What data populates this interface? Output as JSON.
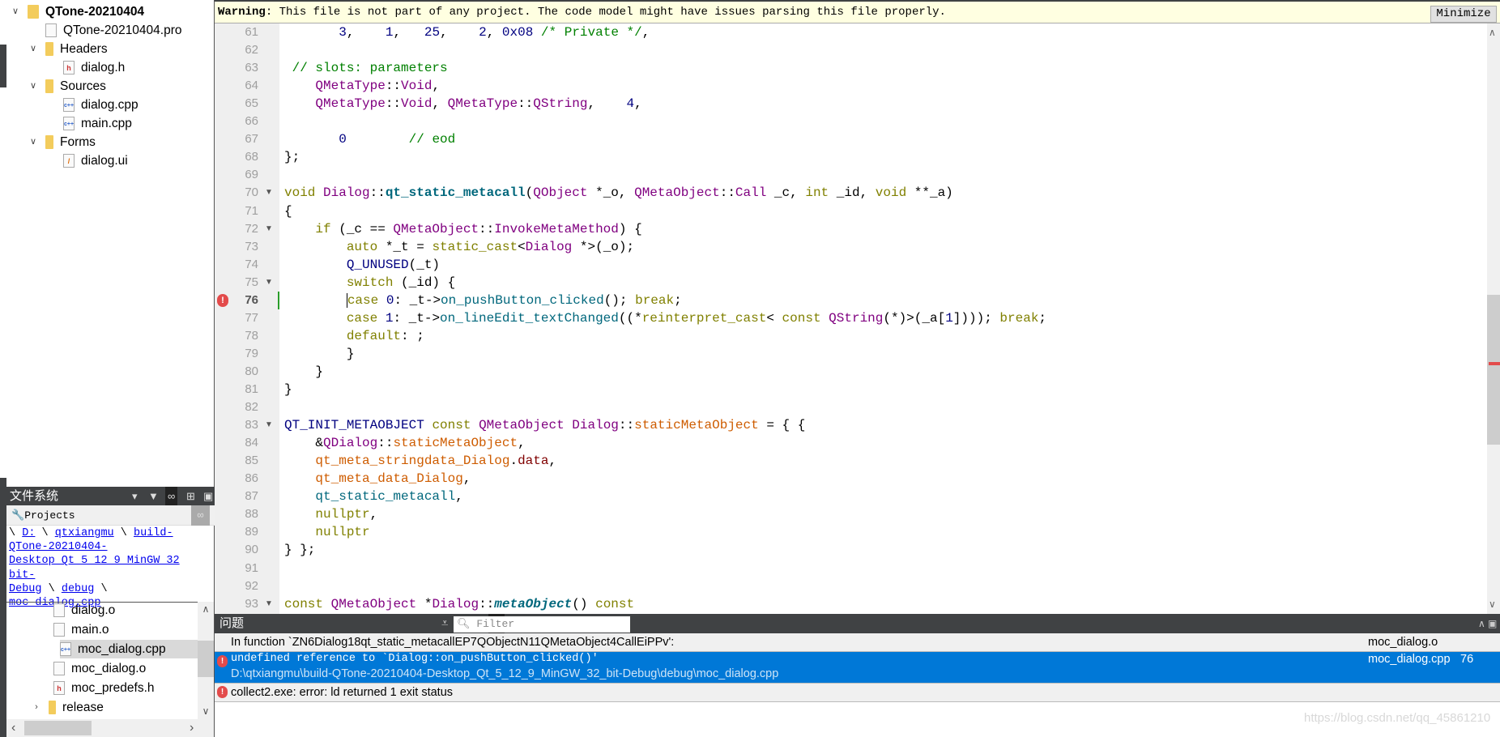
{
  "project_tree": {
    "root": "QTone-20210404",
    "items": [
      {
        "label": "QTone-20210404.pro",
        "icon": "qt-project-file-icon"
      },
      {
        "label": "Headers",
        "icon": "headers-folder-icon"
      },
      {
        "label": "dialog.h",
        "icon": "header-file-icon"
      },
      {
        "label": "Sources",
        "icon": "sources-folder-icon"
      },
      {
        "label": "dialog.cpp",
        "icon": "cpp-file-icon"
      },
      {
        "label": "main.cpp",
        "icon": "cpp-file-icon"
      },
      {
        "label": "Forms",
        "icon": "forms-folder-icon"
      },
      {
        "label": "dialog.ui",
        "icon": "ui-file-icon"
      }
    ]
  },
  "filesystem": {
    "title": "文件系统",
    "combo": "Projects",
    "path": {
      "sep": "\\",
      "d": "D:",
      "p1": "qtxiangmu",
      "p2a": "build-",
      "p2b": "QTone-20210404-",
      "p2c": "Desktop Qt 5 12 9 MinGW 32 bit-",
      "p2d": "Debug",
      "p3": "debug",
      "p4": "moc dialog.cpp"
    },
    "files": [
      {
        "label": "dialog.o"
      },
      {
        "label": "main.o"
      },
      {
        "label": "moc_dialog.cpp",
        "selected": true
      },
      {
        "label": "moc_dialog.o"
      },
      {
        "label": "moc_predefs.h"
      },
      {
        "label": "release"
      }
    ]
  },
  "editor": {
    "warning_label": "Warning",
    "warning_text": ": This file is not part of any project. The code model might have issues parsing this file properly.",
    "minimize": "Minimize",
    "current_line": 76,
    "error_line": 76,
    "fold_lines": [
      70,
      72,
      75,
      83,
      93
    ],
    "lines": [
      {
        "n": 61,
        "t": [
          [
            "       ",
            ""
          ],
          [
            "3",
            "n"
          ],
          [
            ",    ",
            ""
          ],
          [
            "1",
            "n"
          ],
          [
            ",   ",
            ""
          ],
          [
            "25",
            "n"
          ],
          [
            ",    ",
            ""
          ],
          [
            "2",
            "n"
          ],
          [
            ", ",
            ""
          ],
          [
            "0x08",
            "n"
          ],
          [
            " ",
            ""
          ],
          [
            "/* Private */",
            "c"
          ],
          [
            ",",
            ""
          ]
        ]
      },
      {
        "n": 62,
        "t": []
      },
      {
        "n": 63,
        "t": [
          [
            " // slots: parameters",
            "c"
          ]
        ]
      },
      {
        "n": 64,
        "t": [
          [
            "    ",
            ""
          ],
          [
            "QMetaType",
            "t"
          ],
          [
            "::",
            ""
          ],
          [
            "Void",
            "t"
          ],
          [
            ",",
            ""
          ]
        ]
      },
      {
        "n": 65,
        "t": [
          [
            "    ",
            ""
          ],
          [
            "QMetaType",
            "t"
          ],
          [
            "::",
            ""
          ],
          [
            "Void",
            "t"
          ],
          [
            ", ",
            ""
          ],
          [
            "QMetaType",
            "t"
          ],
          [
            "::",
            ""
          ],
          [
            "QString",
            "t"
          ],
          [
            ",    ",
            ""
          ],
          [
            "4",
            "n"
          ],
          [
            ",",
            ""
          ]
        ]
      },
      {
        "n": 66,
        "t": []
      },
      {
        "n": 67,
        "t": [
          [
            "       ",
            ""
          ],
          [
            "0",
            "n"
          ],
          [
            "        ",
            ""
          ],
          [
            "// eod",
            "c"
          ]
        ]
      },
      {
        "n": 68,
        "t": [
          [
            "};",
            ""
          ]
        ]
      },
      {
        "n": 69,
        "t": []
      },
      {
        "n": 70,
        "t": [
          [
            "void",
            "k"
          ],
          [
            " ",
            ""
          ],
          [
            "Dialog",
            "t"
          ],
          [
            "::",
            ""
          ],
          [
            "qt_static_metacall",
            "fb"
          ],
          [
            "(",
            ""
          ],
          [
            "QObject",
            "t"
          ],
          [
            " *_o, ",
            ""
          ],
          [
            "QMetaObject",
            "t"
          ],
          [
            "::",
            ""
          ],
          [
            "Call",
            "t"
          ],
          [
            " _c, ",
            ""
          ],
          [
            "int",
            "k"
          ],
          [
            " _id, ",
            ""
          ],
          [
            "void",
            "k"
          ],
          [
            " **_a)",
            ""
          ]
        ]
      },
      {
        "n": 71,
        "t": [
          [
            "{",
            ""
          ]
        ]
      },
      {
        "n": 72,
        "t": [
          [
            "    ",
            ""
          ],
          [
            "if",
            "k"
          ],
          [
            " (_c == ",
            ""
          ],
          [
            "QMetaObject",
            "t"
          ],
          [
            "::",
            ""
          ],
          [
            "InvokeMetaMethod",
            "t"
          ],
          [
            ") {",
            ""
          ]
        ]
      },
      {
        "n": 73,
        "t": [
          [
            "        ",
            ""
          ],
          [
            "auto",
            "k"
          ],
          [
            " *_t = ",
            ""
          ],
          [
            "static_cast",
            "k"
          ],
          [
            "<",
            ""
          ],
          [
            "Dialog",
            "t"
          ],
          [
            " *>(_o);",
            ""
          ]
        ]
      },
      {
        "n": 74,
        "t": [
          [
            "        ",
            ""
          ],
          [
            "Q_UNUSED",
            "m"
          ],
          [
            "(_t)",
            ""
          ]
        ]
      },
      {
        "n": 75,
        "t": [
          [
            "        ",
            ""
          ],
          [
            "switch",
            "k"
          ],
          [
            " (_id) {",
            ""
          ]
        ]
      },
      {
        "n": 76,
        "t": [
          [
            "        ",
            ""
          ],
          [
            "case",
            "k"
          ],
          [
            " ",
            ""
          ],
          [
            "0",
            "n"
          ],
          [
            ": _t->",
            ""
          ],
          [
            "on_pushButton_clicked",
            "f"
          ],
          [
            "(); ",
            ""
          ],
          [
            "break",
            "k"
          ],
          [
            ";",
            ""
          ]
        ]
      },
      {
        "n": 77,
        "t": [
          [
            "        ",
            ""
          ],
          [
            "case",
            "k"
          ],
          [
            " ",
            ""
          ],
          [
            "1",
            "n"
          ],
          [
            ": _t->",
            ""
          ],
          [
            "on_lineEdit_textChanged",
            "f"
          ],
          [
            "((*",
            ""
          ],
          [
            "reinterpret_cast",
            "k"
          ],
          [
            "< ",
            ""
          ],
          [
            "const",
            "k"
          ],
          [
            " ",
            ""
          ],
          [
            "QString",
            "t"
          ],
          [
            "(*)>(_a[",
            ""
          ],
          [
            "1",
            "n"
          ],
          [
            "]))); ",
            ""
          ],
          [
            "break",
            "k"
          ],
          [
            ";",
            ""
          ]
        ]
      },
      {
        "n": 78,
        "t": [
          [
            "        ",
            ""
          ],
          [
            "default",
            "k"
          ],
          [
            ": ;",
            ""
          ]
        ]
      },
      {
        "n": 79,
        "t": [
          [
            "        }",
            ""
          ]
        ]
      },
      {
        "n": 80,
        "t": [
          [
            "    }",
            ""
          ]
        ]
      },
      {
        "n": 81,
        "t": [
          [
            "}",
            ""
          ]
        ]
      },
      {
        "n": 82,
        "t": []
      },
      {
        "n": 83,
        "t": [
          [
            "QT_INIT_METAOBJECT",
            "m"
          ],
          [
            " ",
            ""
          ],
          [
            "const",
            "k"
          ],
          [
            " ",
            ""
          ],
          [
            "QMetaObject",
            "t"
          ],
          [
            " ",
            ""
          ],
          [
            "Dialog",
            "t"
          ],
          [
            "::",
            ""
          ],
          [
            "staticMetaObject",
            "s"
          ],
          [
            " = { {",
            ""
          ]
        ]
      },
      {
        "n": 84,
        "t": [
          [
            "    &",
            ""
          ],
          [
            "QDialog",
            "t"
          ],
          [
            "::",
            ""
          ],
          [
            "staticMetaObject",
            "s"
          ],
          [
            ",",
            ""
          ]
        ]
      },
      {
        "n": 85,
        "t": [
          [
            "    ",
            ""
          ],
          [
            "qt_meta_stringdata_Dialog",
            "s"
          ],
          [
            ".",
            ""
          ],
          [
            "data",
            "d"
          ],
          [
            ",",
            ""
          ]
        ]
      },
      {
        "n": 86,
        "t": [
          [
            "    ",
            ""
          ],
          [
            "qt_meta_data_Dialog",
            "s"
          ],
          [
            ",",
            ""
          ]
        ]
      },
      {
        "n": 87,
        "t": [
          [
            "    ",
            ""
          ],
          [
            "qt_static_metacall",
            "f"
          ],
          [
            ",",
            ""
          ]
        ]
      },
      {
        "n": 88,
        "t": [
          [
            "    ",
            ""
          ],
          [
            "nullptr",
            "k"
          ],
          [
            ",",
            ""
          ]
        ]
      },
      {
        "n": 89,
        "t": [
          [
            "    ",
            ""
          ],
          [
            "nullptr",
            "k"
          ]
        ]
      },
      {
        "n": 90,
        "t": [
          [
            "} };",
            ""
          ]
        ]
      },
      {
        "n": 91,
        "t": []
      },
      {
        "n": 92,
        "t": []
      },
      {
        "n": 93,
        "t": [
          [
            "const",
            "k"
          ],
          [
            " ",
            ""
          ],
          [
            "QMetaObject",
            "t"
          ],
          [
            " *",
            ""
          ],
          [
            "Dialog",
            "t"
          ],
          [
            "::",
            ""
          ],
          [
            "metaObject",
            "fbi"
          ],
          [
            "() ",
            ""
          ],
          [
            "const",
            "k"
          ]
        ]
      }
    ]
  },
  "issues": {
    "title": "问题",
    "filter_placeholder": "Filter",
    "rows": [
      {
        "text": "In function `ZN6Dialog18qt_static_metacallEP7QObjectN11QMetaObject4CallEiPPv':",
        "file": "moc_dialog.o",
        "line": ""
      },
      {
        "text": "undefined reference to `Dialog::on_pushButton_clicked()'",
        "detail": "D:\\qtxiangmu\\build-QTone-20210404-Desktop_Qt_5_12_9_MinGW_32_bit-Debug\\debug\\moc_dialog.cpp",
        "file": "moc_dialog.cpp",
        "line": "76",
        "selected": true
      },
      {
        "text": "collect2.exe: error: ld returned 1 exit status",
        "file": "",
        "line": ""
      }
    ]
  },
  "watermark": "https://blog.csdn.net/qq_45861210",
  "colors": {
    "selection": "#0078d7",
    "error": "#e34b4b",
    "warning_bg": "#ffffe1",
    "panel_dark": "#404244"
  }
}
